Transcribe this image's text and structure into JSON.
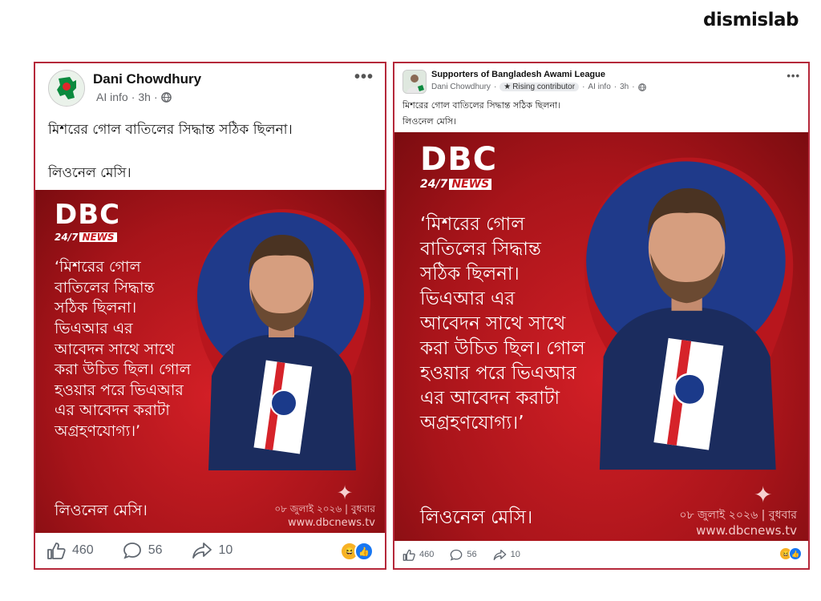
{
  "brand": "dismislab",
  "colors": {
    "frame": "#b5283a",
    "post_bg": "#c4161c",
    "like": "#1877f2"
  },
  "post1": {
    "author": "Dani Chowdhury",
    "meta_label": "AI info",
    "time": "3h",
    "text_line1": "মিশরের গোল বাতিলের সিদ্ধান্ত সঠিক ছিলনা।",
    "text_line2": "লিওনেল মেসি।",
    "image": {
      "logo_big": "DBC",
      "logo_small": "24/7",
      "logo_news": "NEWS",
      "quote_lines": [
        "‘মিশরের গোল",
        "বাতিলের সিদ্ধান্ত",
        "সঠিক ছিলনা।",
        "ভিএআর এর",
        "আবেদন সাথে সাথে",
        "করা উচিত ছিল। গোল",
        "হওয়ার পরে ভিএআর",
        "এর আবেদন করাটা",
        "অগ্রহণযোগ্য।’"
      ],
      "signature": "লিওনেল মেসি।",
      "date": "০৮ জুলাই ২০২৬ | বুধবার",
      "site": "www.dbcnews.tv"
    },
    "likes": "460",
    "comments": "56",
    "shares": "10"
  },
  "post2": {
    "group": "Supporters of Bangladesh Awami League",
    "author": "Dani Chowdhury",
    "badge": "Rising contributor",
    "meta_label": "AI info",
    "time": "3h",
    "text_line1": "মিশরের গোল বাতিলের সিদ্ধান্ত সঠিক ছিলনা।",
    "text_line2": "লিওনেল মেসি।",
    "image": {
      "logo_big": "DBC",
      "logo_small": "24/7",
      "logo_news": "NEWS",
      "quote_lines": [
        "‘মিশরের গোল",
        "বাতিলের সিদ্ধান্ত",
        "সঠিক ছিলনা।",
        "ভিএআর এর",
        "আবেদন সাথে সাথে",
        "করা উচিত ছিল। গোল",
        "হওয়ার পরে ভিএআর",
        "এর আবেদন করাটা",
        "অগ্রহণযোগ্য।’"
      ],
      "signature": "লিওনেল মেসি।",
      "date": "০৮ জুলাই ২০২৬ | বুধবার",
      "site": "www.dbcnews.tv"
    },
    "likes": "460",
    "comments": "56",
    "shares": "10"
  }
}
